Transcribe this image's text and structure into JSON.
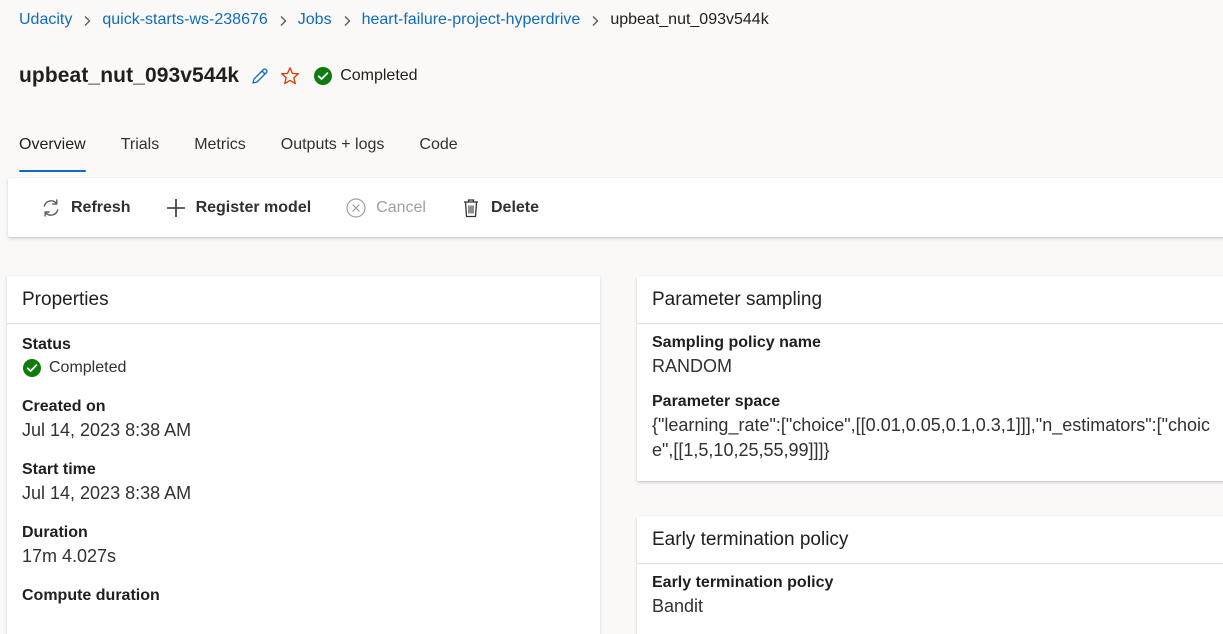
{
  "breadcrumb": {
    "items": [
      "Udacity",
      "quick-starts-ws-238676",
      "Jobs",
      "heart-failure-project-hyperdrive"
    ],
    "current": "upbeat_nut_093v544k"
  },
  "header": {
    "title": "upbeat_nut_093v544k",
    "status": "Completed"
  },
  "tabs": [
    {
      "label": "Overview",
      "active": true
    },
    {
      "label": "Trials",
      "active": false
    },
    {
      "label": "Metrics",
      "active": false
    },
    {
      "label": "Outputs + logs",
      "active": false
    },
    {
      "label": "Code",
      "active": false
    }
  ],
  "toolbar": {
    "refresh_label": "Refresh",
    "register_label": "Register model",
    "cancel_label": "Cancel",
    "delete_label": "Delete"
  },
  "properties": {
    "title": "Properties",
    "status_label": "Status",
    "status_value": "Completed",
    "created_label": "Created on",
    "created_value": "Jul 14, 2023 8:38 AM",
    "start_label": "Start time",
    "start_value": "Jul 14, 2023 8:38 AM",
    "duration_label": "Duration",
    "duration_value": "17m 4.027s",
    "compute_label": "Compute duration"
  },
  "sampling": {
    "title": "Parameter sampling",
    "policy_label": "Sampling policy name",
    "policy_value": "RANDOM",
    "space_label": "Parameter space",
    "space_value": "{\"learning_rate\":[\"choice\",[[0.01,0.05,0.1,0.3,1]]],\"n_estimators\":[\"choice\",[[1,5,10,25,55,99]]]}"
  },
  "termination": {
    "title": "Early termination policy",
    "policy_label": "Early termination policy",
    "policy_value": "Bandit"
  },
  "colors": {
    "link": "#0f6cbd",
    "success": "#107c10",
    "star": "#d83b01"
  },
  "icons": {
    "edit": "pencil-icon",
    "favorite": "star-icon",
    "status": "check-circle-icon",
    "refresh": "refresh-icon",
    "register": "plus-icon",
    "cancel": "cancel-circle-icon",
    "delete": "trash-icon",
    "separator": "chevron-right-icon"
  }
}
